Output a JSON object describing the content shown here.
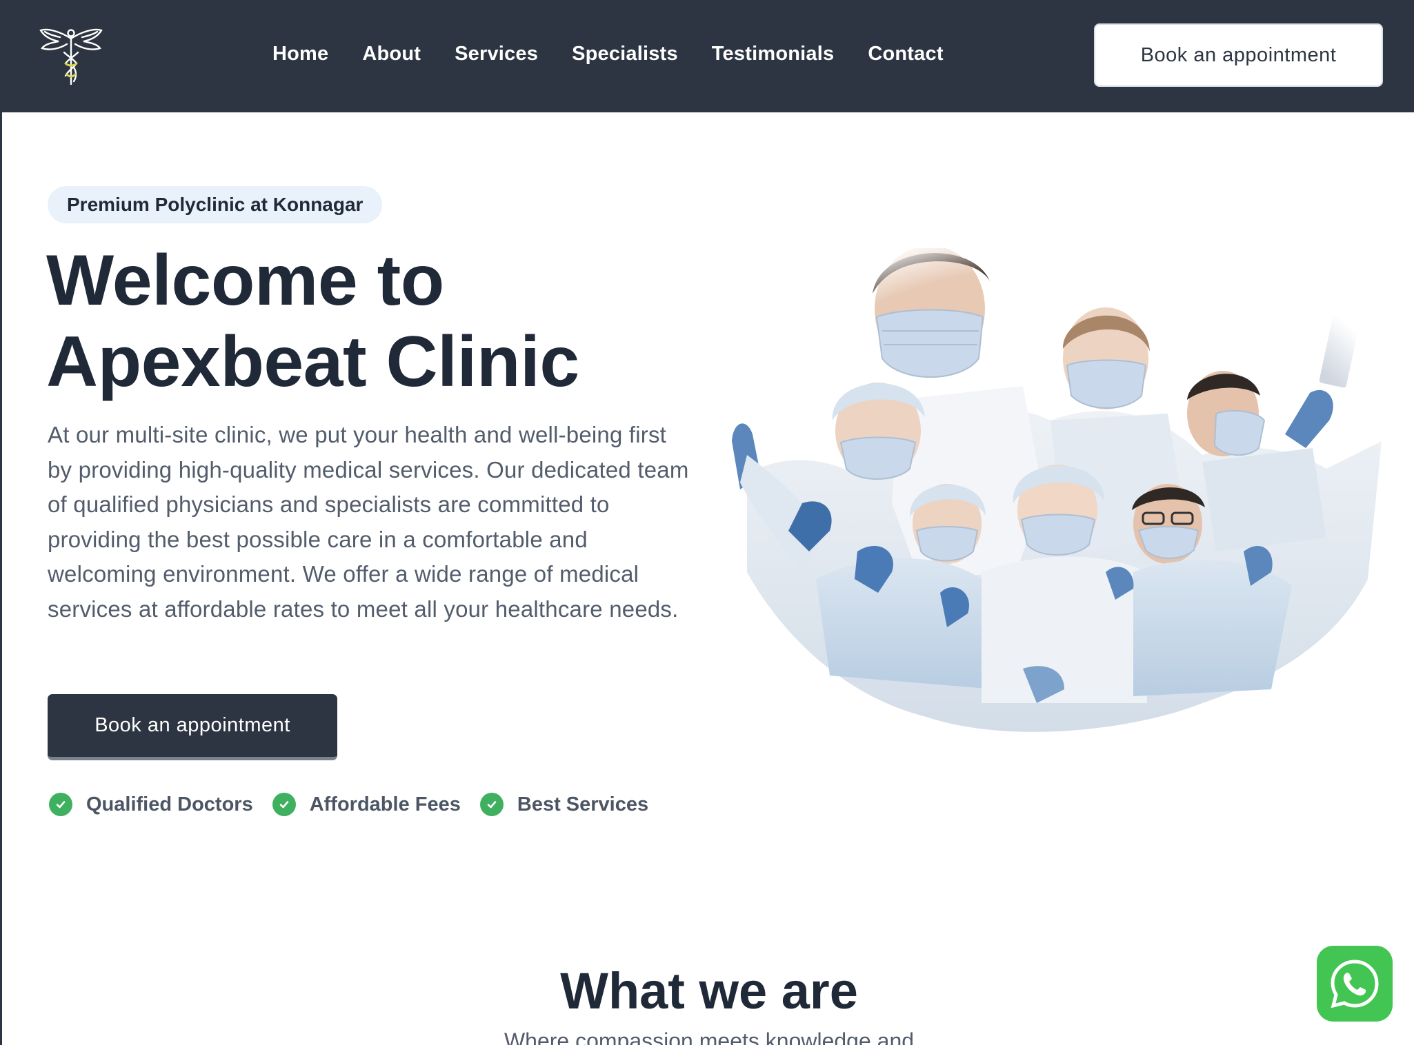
{
  "header": {
    "nav": [
      "Home",
      "About",
      "Services",
      "Specialists",
      "Testimonials",
      "Contact"
    ],
    "cta_label": "Book an appointment"
  },
  "hero": {
    "badge": "Premium Polyclinic at Konnagar",
    "title": "Welcome to\nApexbeat Clinic",
    "description": "At our multi-site clinic, we put your health and well-being first by providing high-quality medical services. Our dedicated team of qualified physicians and specialists are committed to providing the best possible care in a comfortable and welcoming environment. We offer a wide range of medical services at affordable rates to meet all your healthcare needs.",
    "cta_label": "Book an appointment",
    "features": [
      "Qualified Doctors",
      "Affordable Fees",
      "Best Services"
    ]
  },
  "about": {
    "title": "What we are",
    "subtitle": "Where compassion meets knowledge and"
  },
  "colors": {
    "navy": "#2d3542",
    "badge_bg": "#e9f1fb",
    "check_green": "#3fb05f",
    "whatsapp_green": "#43c553"
  },
  "icons": {
    "logo": "winged-caduceus-logo",
    "check": "check-circle-icon",
    "whatsapp": "whatsapp-icon"
  }
}
